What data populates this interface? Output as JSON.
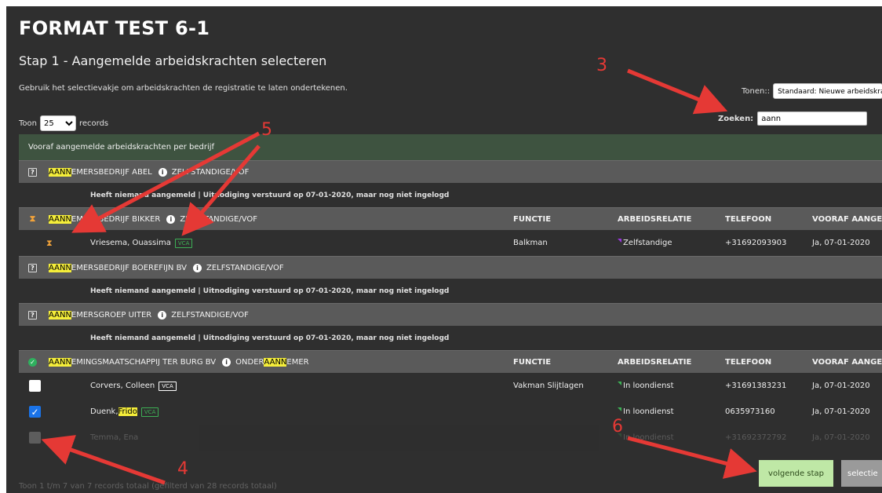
{
  "page": {
    "title": "FORMAT TEST 6-1",
    "step_title": "Stap 1 - Aangemelde arbeidskrachten selecteren",
    "help_text": "Gebruik het selectievakje om arbeidskrachten de registratie te laten ondertekenen."
  },
  "controls": {
    "toon_label": "Toon",
    "records_value": "25",
    "records_label": "records",
    "tonen_label": "Tonen::",
    "tonen_value": "Standaard: Nieuwe arbeidskra",
    "zoeken_label": "Zoeken:",
    "zoeken_value": "aann"
  },
  "table": {
    "header": "Vooraf aangemelde arbeidskrachten per bedrijf",
    "columns": [
      "FUNCTIE",
      "ARBEIDSRELATIE",
      "TELEFOON",
      "VOORAF AANGEMELD"
    ],
    "info_text": "Heeft niemand aangemeld  |  Uitnodiging verstuurd op 07-01-2020, maar nog niet ingelogd",
    "groups": [
      {
        "hl": "AANN",
        "rest": "EMERSBEDRIJF ABEL",
        "type": "ZELFSTANDIGE/VOF",
        "status": "?"
      },
      {
        "hl": "AANN",
        "rest": "EMERSBEDRIJF BIKKER",
        "type": "ZELFSTANDIGE/VOF",
        "status": "⧗"
      },
      {
        "hl": "AANN",
        "rest": "EMERSBEDRIJF BOEREFIJN BV",
        "type": "ZELFSTANDIGE/VOF",
        "status": "?"
      },
      {
        "hl": "AANN",
        "rest": "EMERSGROEP UITER",
        "type": "ZELFSTANDIGE/VOF",
        "status": "?"
      },
      {
        "hl": "AANN",
        "rest": "EMINGSMAATSCHAPPIJ TER BURG BV",
        "type_pre": "ONDER",
        "type_hl": "AANN",
        "type_post": "EMER",
        "status": "✓"
      }
    ],
    "persons": [
      {
        "name": "Vriesema, Ouassima",
        "vca": "VCA",
        "functie": "Balkman",
        "relatie": "Zelfstandige",
        "telefoon": "+31692093903",
        "vooraf": "Ja, 07-01-2020"
      },
      {
        "name": "Corvers, Colleen",
        "vca": "VCA",
        "functie": "Vakman Slijtlagen",
        "relatie": "In loondienst",
        "telefoon": "+31691383231",
        "vooraf": "Ja, 07-01-2020"
      },
      {
        "name_pre": "Duenk, ",
        "name_hl": "Frido",
        "vca": "VCA",
        "functie": "",
        "relatie": "In loondienst",
        "telefoon": "0635973160",
        "vooraf": "Ja, 07-01-2020"
      },
      {
        "name": "Temma, Ena",
        "relatie": "In loondienst",
        "telefoon": "+31692372792",
        "vooraf": "Ja, 07-01-2020"
      }
    ]
  },
  "footer": {
    "text": "Toon 1 t/m 7 van 7 records totaal (gefilterd van 28 records totaal)"
  },
  "buttons": {
    "next": "volgende stap",
    "select": "selectie"
  },
  "annotations": [
    "3",
    "5",
    "4",
    "6"
  ],
  "colors": {
    "highlight": "#f5ee3a",
    "annotation": "#e53935",
    "next_button": "#bfe8a6",
    "header_green": "#3e5340"
  }
}
